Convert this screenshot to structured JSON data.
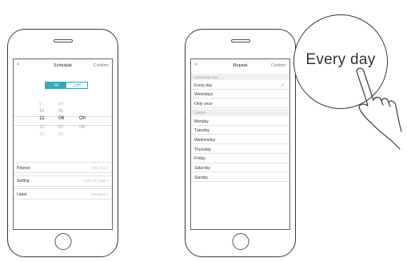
{
  "left_phone": {
    "header": {
      "back": "<",
      "title": "Schedule",
      "confirm": "Confirm"
    },
    "format_toggle": {
      "options": [
        "24",
        "12H"
      ],
      "selected": "24"
    },
    "picker": {
      "rows": [
        {
          "hour": "9",
          "minute": "04",
          "state": ""
        },
        {
          "hour": "10",
          "minute": "05",
          "state": ""
        },
        {
          "hour": "11",
          "minute": "06",
          "state": "On"
        },
        {
          "hour": "12",
          "minute": "07",
          "state": "Off"
        },
        {
          "hour": "13",
          "minute": "08",
          "state": ""
        }
      ],
      "selected_index": 2
    },
    "settings": [
      {
        "label": "Repeat",
        "value": "Mon,Thu >"
      },
      {
        "label": "Setting",
        "value": "Cool,17C,High >"
      },
      {
        "label": "Label",
        "value": "Unnamed >"
      }
    ]
  },
  "right_phone": {
    "header": {
      "back": "<",
      "title": "Repeat",
      "confirm": "Confirm"
    },
    "common_heading": "Commonly used",
    "common_items": [
      "Every day",
      "Weekdays",
      "Only once"
    ],
    "selected_item": "Every day",
    "custom_heading": "Custom",
    "custom_items": [
      "Monday",
      "Tuesday",
      "Wednesday",
      "Thursday",
      "Friday",
      "Saturday",
      "Sunday"
    ]
  },
  "callout": {
    "text": "Every day"
  },
  "colors": {
    "accent": "#3aa7b9",
    "frame": "#3a3a3a"
  },
  "icons": {
    "check": "check-icon",
    "hand": "pointing-hand-icon"
  }
}
